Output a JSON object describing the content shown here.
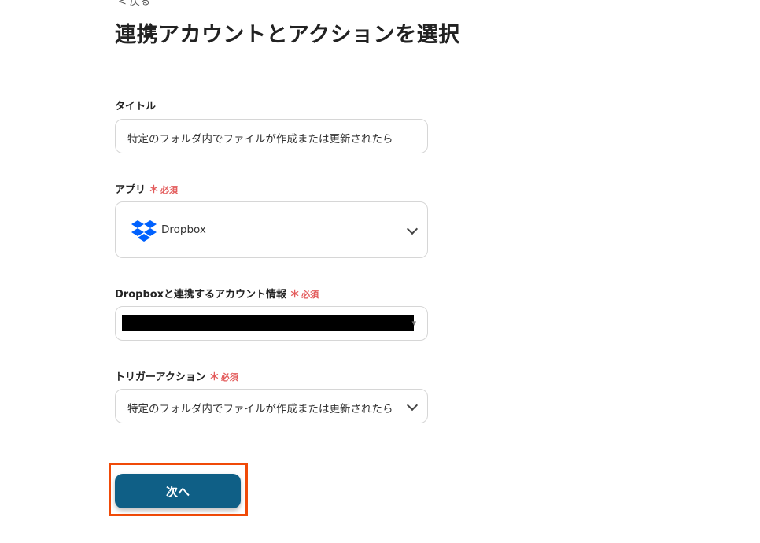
{
  "header": {
    "back_label": "< 戻る",
    "title": "連携アカウントとアクションを選択"
  },
  "form": {
    "title_field": {
      "label": "タイトル",
      "value": "特定のフォルダ内でファイルが作成または更新されたら"
    },
    "app_field": {
      "label": "アプリ",
      "required": "必須",
      "required_mark": "＊",
      "value": "Dropbox",
      "icon": "dropbox-logo",
      "brand_color": "#0061fe"
    },
    "account_field": {
      "label": "Dropboxと連携するアカウント情報",
      "required": "必須",
      "required_mark": "＊"
    },
    "trigger_field": {
      "label": "トリガーアクション",
      "required": "必須",
      "required_mark": "＊",
      "value": "特定のフォルダ内でファイルが作成または更新されたら"
    }
  },
  "actions": {
    "next_label": "次へ",
    "button_color": "#0f5f86",
    "highlight_color": "#f04a08"
  }
}
